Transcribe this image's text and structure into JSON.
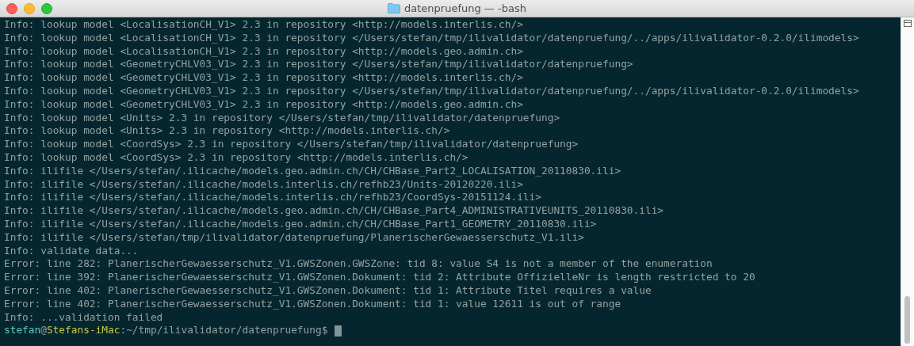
{
  "window": {
    "title": "datenpruefung — -bash"
  },
  "lines": [
    "Info: lookup model <LocalisationCH_V1> 2.3 in repository <http://models.interlis.ch/>",
    "Info: lookup model <LocalisationCH_V1> 2.3 in repository </Users/stefan/tmp/ilivalidator/datenpruefung/../apps/ilivalidator-0.2.0/ilimodels>",
    "Info: lookup model <LocalisationCH_V1> 2.3 in repository <http://models.geo.admin.ch>",
    "Info: lookup model <GeometryCHLV03_V1> 2.3 in repository </Users/stefan/tmp/ilivalidator/datenpruefung>",
    "Info: lookup model <GeometryCHLV03_V1> 2.3 in repository <http://models.interlis.ch/>",
    "Info: lookup model <GeometryCHLV03_V1> 2.3 in repository </Users/stefan/tmp/ilivalidator/datenpruefung/../apps/ilivalidator-0.2.0/ilimodels>",
    "Info: lookup model <GeometryCHLV03_V1> 2.3 in repository <http://models.geo.admin.ch>",
    "Info: lookup model <Units> 2.3 in repository </Users/stefan/tmp/ilivalidator/datenpruefung>",
    "Info: lookup model <Units> 2.3 in repository <http://models.interlis.ch/>",
    "Info: lookup model <CoordSys> 2.3 in repository </Users/stefan/tmp/ilivalidator/datenpruefung>",
    "Info: lookup model <CoordSys> 2.3 in repository <http://models.interlis.ch/>",
    "Info: ilifile </Users/stefan/.ilicache/models.geo.admin.ch/CH/CHBase_Part2_LOCALISATION_20110830.ili>",
    "Info: ilifile </Users/stefan/.ilicache/models.interlis.ch/refhb23/Units-20120220.ili>",
    "Info: ilifile </Users/stefan/.ilicache/models.interlis.ch/refhb23/CoordSys-20151124.ili>",
    "Info: ilifile </Users/stefan/.ilicache/models.geo.admin.ch/CH/CHBase_Part4_ADMINISTRATIVEUNITS_20110830.ili>",
    "Info: ilifile </Users/stefan/.ilicache/models.geo.admin.ch/CH/CHBase_Part1_GEOMETRY_20110830.ili>",
    "Info: ilifile </Users/stefan/tmp/ilivalidator/datenpruefung/PlanerischerGewaesserschutz_V1.ili>",
    "Info: validate data...",
    "Error: line 282: PlanerischerGewaesserschutz_V1.GWSZonen.GWSZone: tid 8: value S4 is not a member of the enumeration",
    "Error: line 392: PlanerischerGewaesserschutz_V1.GWSZonen.Dokument: tid 2: Attribute OffizielleNr is length restricted to 20",
    "Error: line 402: PlanerischerGewaesserschutz_V1.GWSZonen.Dokument: tid 1: Attribute Titel requires a value",
    "Error: line 402: PlanerischerGewaesserschutz_V1.GWSZonen.Dokument: tid 1: value 12611 is out of range",
    "Info: ...validation failed"
  ],
  "prompt": {
    "user": "stefan",
    "at": "@",
    "host": "Stefans-iMac",
    "separator": ":",
    "path": "~/tmp/ilivalidator/datenpruefung",
    "symbol": "$"
  }
}
